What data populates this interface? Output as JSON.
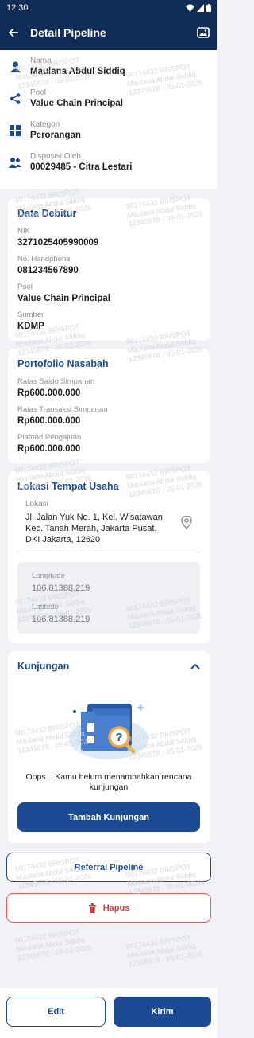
{
  "status": {
    "time": "12:30"
  },
  "appbar": {
    "title": "Detail Pipeline"
  },
  "header": {
    "nama": {
      "label": "Nama",
      "value": "Maulana Abdul Siddiq"
    },
    "pool": {
      "label": "Pool",
      "value": "Value Chain Principal"
    },
    "kategori": {
      "label": "Kategori",
      "value": "Perorangan"
    },
    "disposisi": {
      "label": "Disposisi Oleh",
      "value": "00029485 - Citra Lestari"
    }
  },
  "debitur": {
    "title": "Data Debitur",
    "nik": {
      "label": "NIK",
      "value": "3271025405990009"
    },
    "hp": {
      "label": "No. Handphone",
      "value": "081234567890"
    },
    "pool": {
      "label": "Pool",
      "value": "Value Chain Principal"
    },
    "sumber": {
      "label": "Sumber",
      "value": "KDMP"
    }
  },
  "portofolio": {
    "title": "Portofolio Nasabah",
    "saldo": {
      "label": "Ratas Saldo Simpanan",
      "value": "Rp600.000.000"
    },
    "transaksi": {
      "label": "Ratas Transaksi Simpanan",
      "value": "Rp600.000.000"
    },
    "plafond": {
      "label": "Plafond Pengajuan",
      "value": "Rp600.000.000"
    }
  },
  "lokasi": {
    "title": "Lokasi Tempat Usaha",
    "label": "Lokasi",
    "address_line1": "Jl. Jalan Yuk No. 1, Kel. Wisatawan,",
    "address_line2": "Kec. Tanah Merah, Jakarta Pusat,",
    "address_line3": "DKI Jakarta, 12620",
    "longitude": {
      "label": "Longitude",
      "value": "106.81388.219"
    },
    "latitude": {
      "label": "Latitude",
      "value": "106.81388.219"
    }
  },
  "kunjungan": {
    "title": "Kunjungan",
    "empty_line1": "Oops... Kamu belum menambahkan rencana",
    "empty_line2": "kunjungan",
    "add_button": "Tambah Kunjungan"
  },
  "actions": {
    "referral": "Referral Pipeline",
    "hapus": "Hapus",
    "edit": "Edit",
    "kirim": "Kirim"
  },
  "watermark": {
    "line1": "90174432 BRISPOT",
    "line2": "Maulana Abdul Siddiq",
    "line3": "12345678 - 05-01-2026"
  },
  "colors": {
    "primary": "#1c4b93",
    "appbar": "#102d57",
    "danger": "#d33b3b"
  },
  "icons": [
    "back-arrow-icon",
    "gallery-icon",
    "person-icon",
    "share-icon",
    "grid-icon",
    "people-icon",
    "location-pin-icon",
    "chevron-up-icon",
    "trash-icon"
  ]
}
